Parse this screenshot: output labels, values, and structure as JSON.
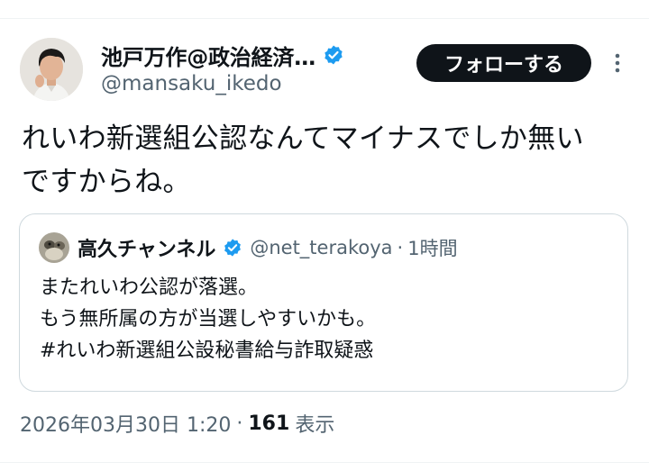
{
  "tweet": {
    "author": {
      "display_name": "池戸万作@政治経済…",
      "handle": "@mansaku_ikedo",
      "avatar_icon": "profile-photo",
      "verified_icon": "verified-badge-icon"
    },
    "follow_label": "フォローする",
    "more_icon": "more-vertical-icon",
    "text_lines": [
      "れいわ新選組公認なんてマイナスでしか無い",
      "ですからね。"
    ],
    "quote": {
      "author": {
        "display_name": "高久チャンネル",
        "handle": "@net_terakoya",
        "verified_icon": "verified-badge-icon"
      },
      "separator": "·",
      "time": "1時間",
      "text_lines": [
        "またれいわ公認が落選。",
        "もう無所属の方が当選しやすいかも。",
        "#れいわ新選組公設秘書給与詐取疑惑"
      ]
    },
    "meta": {
      "timestamp": "2026年03月30日 1:20",
      "separator": "·",
      "views_count": "161",
      "views_label": "表示"
    }
  },
  "colors": {
    "verified_blue": "#1d9bf0",
    "text_primary": "#0f1419",
    "text_secondary": "#536471",
    "border": "#cfd9de",
    "follow_button_bg": "#0f1419"
  }
}
